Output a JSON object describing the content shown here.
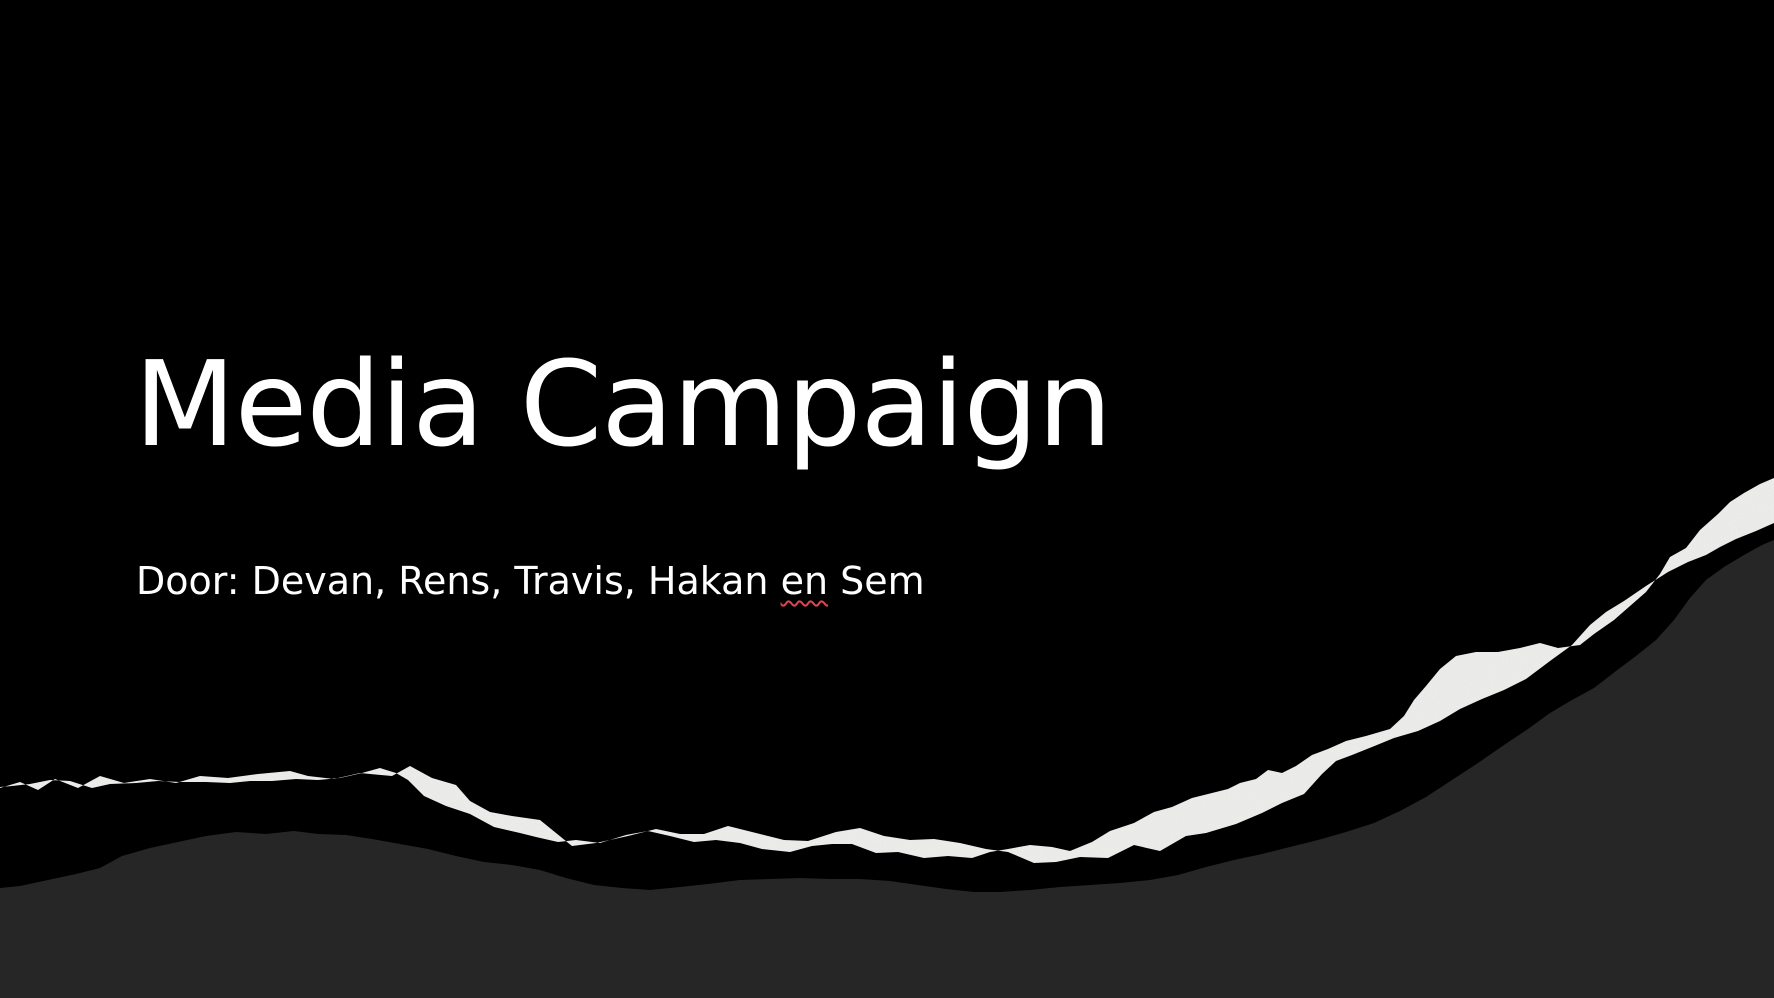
{
  "slide": {
    "title": "Media Campaign",
    "subtitle": {
      "prefix": "Door: Devan, Rens, Travis, Hakan ",
      "flagged_word": "en",
      "suffix": " Sem"
    }
  },
  "colors": {
    "background": "#000000",
    "text": "#ffffff",
    "torn_paper": "#efefed",
    "lower_band": "#262626",
    "spellcheck_underline": "#e0454f"
  }
}
